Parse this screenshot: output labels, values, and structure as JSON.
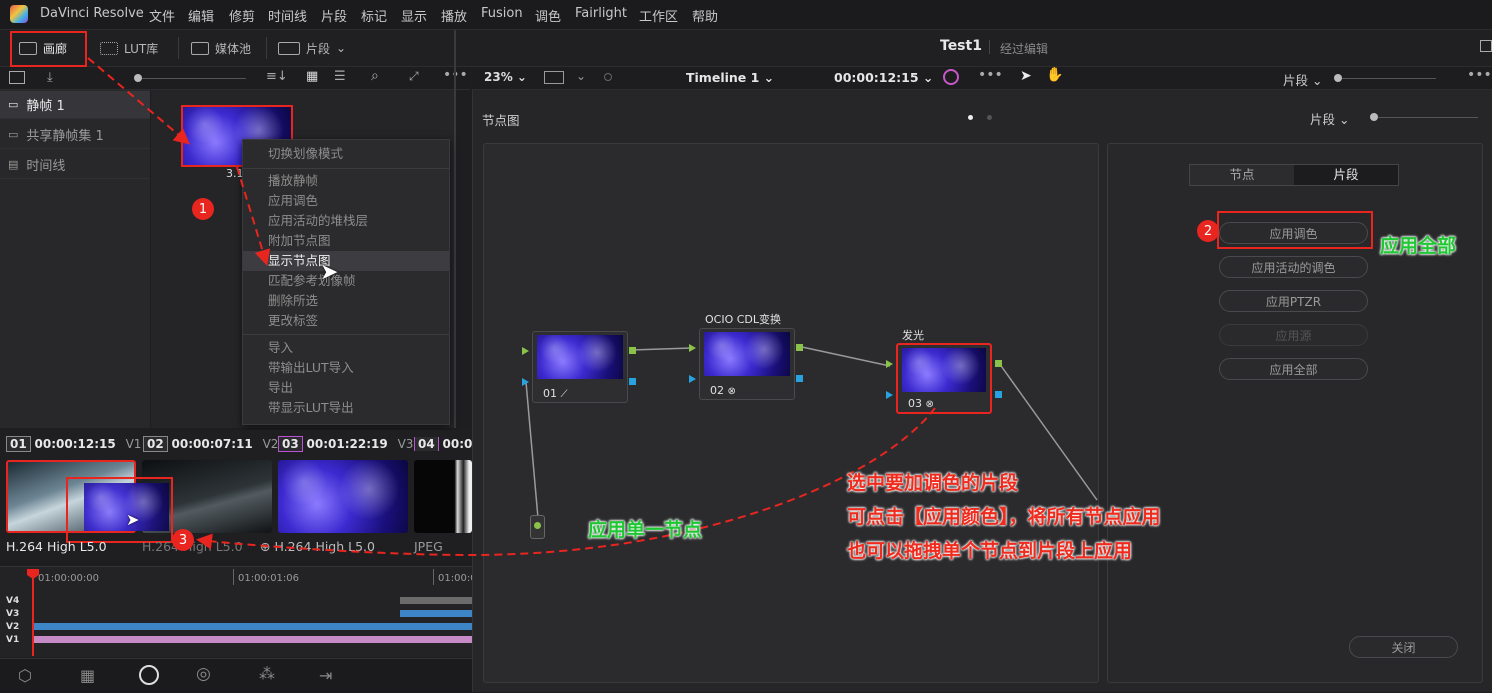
{
  "menubar": {
    "app_name": "DaVinci Resolve",
    "items": [
      "文件",
      "编辑",
      "修剪",
      "时间线",
      "片段",
      "标记",
      "显示",
      "播放",
      "Fusion",
      "调色",
      "Fairlight",
      "工作区",
      "帮助"
    ]
  },
  "toolbar": {
    "gallery": "画廊",
    "lut": "LUT库",
    "media_pool": "媒体池",
    "clips": "片段",
    "project_title": "Test1",
    "project_status": "经过编辑"
  },
  "viewer_bar": {
    "zoom": "23%",
    "timeline_name": "Timeline 1",
    "timecode": "00:00:12:15",
    "clip_mode": "片段"
  },
  "gallery_sidebar": {
    "items": [
      "静帧 1",
      "共享静帧集 1",
      "时间线"
    ]
  },
  "still": {
    "label": "3.1"
  },
  "context_menu": {
    "items": [
      "切换划像模式",
      "播放静帧",
      "应用调色",
      "应用活动的堆栈层",
      "附加节点图",
      "显示节点图",
      "匹配参考划像帧",
      "删除所选",
      "更改标签",
      "导入",
      "带输出LUT导入",
      "导出",
      "带显示LUT导出"
    ]
  },
  "clips": [
    {
      "num": "01",
      "timecode": "00:00:12:15",
      "track": "V1",
      "codec": "H.264 High L5.0"
    },
    {
      "num": "02",
      "timecode": "00:00:07:11",
      "track": "V2",
      "codec": "H.264 High L5.0"
    },
    {
      "num": "03",
      "timecode": "00:01:22:19",
      "track": "V3",
      "codec": "H.264 High L5.0"
    },
    {
      "num": "04",
      "timecode": "00:0",
      "track": "",
      "codec": "JPEG"
    }
  ],
  "timeline_ruler": [
    "01:00:00:00",
    "01:00:01:06",
    "01:00:0"
  ],
  "tracks": [
    "V4",
    "V3",
    "V2",
    "V1"
  ],
  "node_graph": {
    "title": "节点图",
    "mode": "片段",
    "nodes": [
      {
        "num": "01",
        "title": ""
      },
      {
        "num": "02",
        "title": "OCIO CDL变换"
      },
      {
        "num": "03",
        "title": "发光"
      }
    ]
  },
  "right_panel": {
    "tabs": [
      "节点",
      "片段"
    ],
    "buttons": [
      "应用调色",
      "应用活动的调色",
      "应用PTZR",
      "应用源",
      "应用全部"
    ],
    "close": "关闭"
  },
  "annotations": {
    "badge1": "1",
    "badge2": "2",
    "badge3": "3",
    "apply_all": "应用全部",
    "single_node": "应用单一节点",
    "note_line1": "选中要加调色的片段",
    "note_line2": "可点击【应用颜色】，将所有节点应用",
    "note_line3": "也可以拖拽单个节点到片段上应用"
  }
}
